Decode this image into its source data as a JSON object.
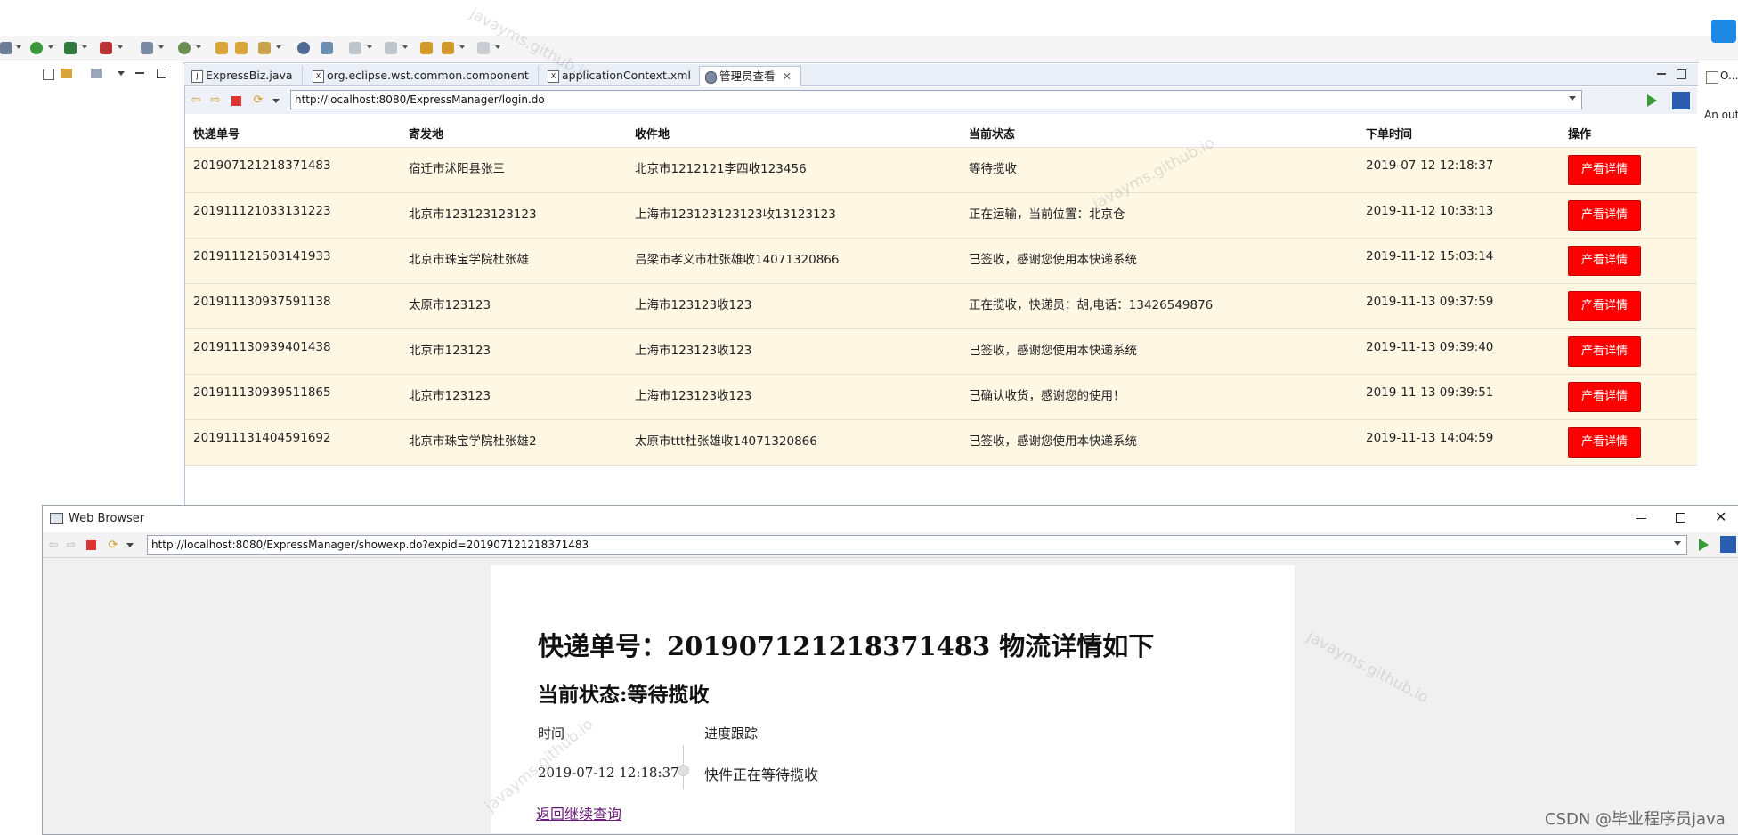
{
  "ide": {
    "tabs": [
      {
        "label": "ExpressBiz.java",
        "icon": "java-file-icon"
      },
      {
        "label": "org.eclipse.wst.common.component",
        "icon": "xml-file-icon"
      },
      {
        "label": "applicationContext.xml",
        "icon": "xml-file-icon"
      },
      {
        "label": "管理员查看",
        "icon": "globe-icon",
        "active": true
      }
    ],
    "url": "http://localhost:8080/ExpressManager/login.do",
    "right_panel_label": "O...",
    "right_panel_text": "An out"
  },
  "table": {
    "headers": [
      "快递单号",
      "寄发地",
      "收件地",
      "当前状态",
      "下单时间",
      "操作"
    ],
    "rows": [
      {
        "id": "201907121218371483",
        "from": "宿迁市沭阳县张三",
        "to": "北京市1212121李四收123456",
        "status": "等待揽收",
        "time": "2019-07-12 12:18:37",
        "action": "产看详情"
      },
      {
        "id": "201911121033131223",
        "from": "北京市123123123123",
        "to": "上海市123123123123收13123123",
        "status": "正在运输，当前位置：北京仓",
        "time": "2019-11-12 10:33:13",
        "action": "产看详情"
      },
      {
        "id": "201911121503141933",
        "from": "北京市珠宝学院杜张雄",
        "to": "吕梁市孝义市杜张雄收14071320866",
        "status": "已签收，感谢您使用本快递系统",
        "time": "2019-11-12 15:03:14",
        "action": "产看详情"
      },
      {
        "id": "201911130937591138",
        "from": "太原市123123",
        "to": "上海市123123收123",
        "status": "正在揽收，快递员：胡,电话：13426549876",
        "time": "2019-11-13 09:37:59",
        "action": "产看详情"
      },
      {
        "id": "201911130939401438",
        "from": "北京市123123",
        "to": "上海市123123收123",
        "status": "已签收，感谢您使用本快递系统",
        "time": "2019-11-13 09:39:40",
        "action": "产看详情"
      },
      {
        "id": "201911130939511865",
        "from": "北京市123123",
        "to": "上海市123123收123",
        "status": "已确认收货，感谢您的使用！",
        "time": "2019-11-13 09:39:51",
        "action": "产看详情"
      },
      {
        "id": "201911131404591692",
        "from": "北京市珠宝学院杜张雄2",
        "to": "太原市ttt杜张雄收14071320866",
        "status": "已签收，感谢您使用本快递系统",
        "time": "2019-11-13 14:04:59",
        "action": "产看详情"
      }
    ]
  },
  "web_browser": {
    "title": "Web Browser",
    "url": "http://localhost:8080/ExpressManager/showexp.do?expid=201907121218371483",
    "heading": "快递单号：201907121218371483 物流详情如下",
    "status": "当前状态:等待揽收",
    "col_time": "时间",
    "col_progress": "进度跟踪",
    "entry_time": "2019-07-12 12:18:37",
    "entry_text": "快件正在等待揽收",
    "back_link": "返回继续查询"
  },
  "watermarks": [
    "javayms.github.io",
    "CSDN @毕业程序员java"
  ],
  "colors": {
    "button_red": "#ff0000",
    "row_bg": "#fdf7e4",
    "link_purple": "#6a1b7a"
  }
}
